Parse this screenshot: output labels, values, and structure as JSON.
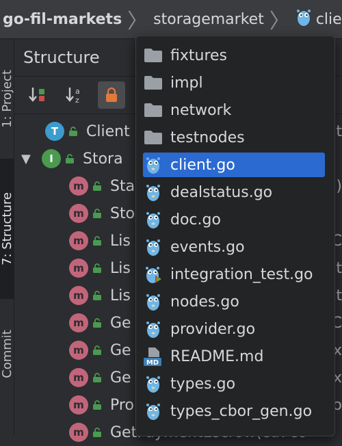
{
  "breadcrumb": {
    "project": "go-fil-markets",
    "folder": "storagemarket",
    "file": "clien"
  },
  "sidebar": {
    "project_tab": "1: Project",
    "structure_tab": "7: Structure",
    "commit_tab": "Commit"
  },
  "structure": {
    "title": "Structure",
    "rows": [
      {
        "kind": "T",
        "label": "Client",
        "trail": "t"
      },
      {
        "kind": "I",
        "label": "Stora",
        "trail": ""
      },
      {
        "kind": "m",
        "label": "Sta",
        "trail": ")"
      },
      {
        "kind": "m",
        "label": "Sto",
        "trail": ""
      },
      {
        "kind": "m",
        "label": "Lis",
        "trail": ".C"
      },
      {
        "kind": "m",
        "label": "Lis",
        "trail": "nt"
      },
      {
        "kind": "m",
        "label": "Lis",
        "trail": "xt"
      },
      {
        "kind": "m",
        "label": "Ge",
        "trail": "t.C"
      },
      {
        "kind": "m",
        "label": "Ge",
        "trail": "ex"
      },
      {
        "kind": "m",
        "label": "Ge",
        "trail": "x"
      },
      {
        "kind": "m",
        "label": "Pro",
        "trail": "o"
      },
      {
        "kind": "m",
        "label": "GetPaymentEscrow(ctx co",
        "trail": ""
      }
    ]
  },
  "popup": {
    "items": [
      {
        "label": "fixtures",
        "icon": "folder-icon"
      },
      {
        "label": "impl",
        "icon": "folder-icon"
      },
      {
        "label": "network",
        "icon": "folder-icon"
      },
      {
        "label": "testnodes",
        "icon": "folder-icon"
      },
      {
        "label": "client.go",
        "icon": "go-file-icon",
        "selected": true
      },
      {
        "label": "dealstatus.go",
        "icon": "go-file-icon"
      },
      {
        "label": "doc.go",
        "icon": "go-file-icon"
      },
      {
        "label": "events.go",
        "icon": "go-file-icon"
      },
      {
        "label": "integration_test.go",
        "icon": "go-test-file-icon"
      },
      {
        "label": "nodes.go",
        "icon": "go-file-icon"
      },
      {
        "label": "provider.go",
        "icon": "go-file-icon"
      },
      {
        "label": "README.md",
        "icon": "markdown-file-icon",
        "badge": "MD"
      },
      {
        "label": "types.go",
        "icon": "go-file-icon"
      },
      {
        "label": "types_cbor_gen.go",
        "icon": "go-file-icon"
      }
    ]
  },
  "colors": {
    "selection": "#2b6ad1",
    "gopher": "#6fb6e6",
    "method_badge": "#c2657b",
    "interface_badge": "#4a9a4f",
    "type_badge": "#3d9bcd"
  }
}
